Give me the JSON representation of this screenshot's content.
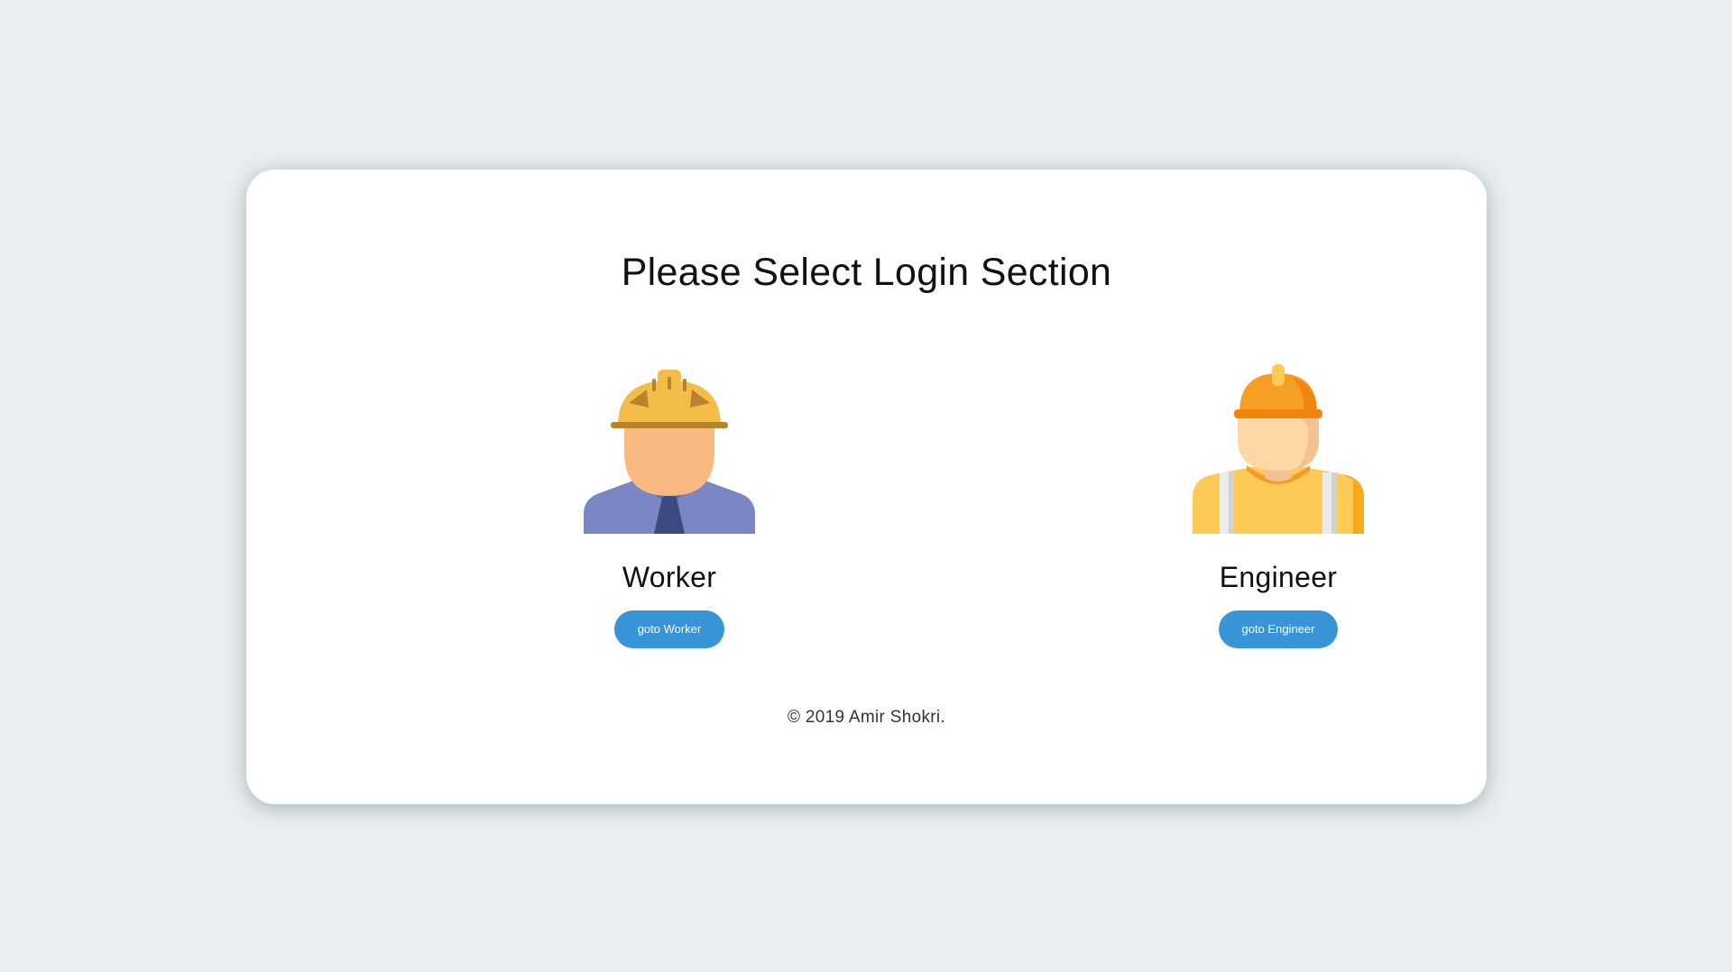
{
  "page": {
    "title": "Please Select Login Section",
    "background_color": "#e9eef0",
    "card_color": "#ffffff"
  },
  "roles": [
    {
      "label": "Worker",
      "button_label": "goto Worker",
      "icon": "worker-hardhat-avatar-icon"
    },
    {
      "label": "Engineer",
      "button_label": "goto Engineer",
      "icon": "engineer-hardhat-avatar-icon"
    }
  ],
  "colors": {
    "button": "#3794d6",
    "button_text": "#ffffff"
  },
  "footer": {
    "text": "© 2019 Amir Shokri."
  }
}
